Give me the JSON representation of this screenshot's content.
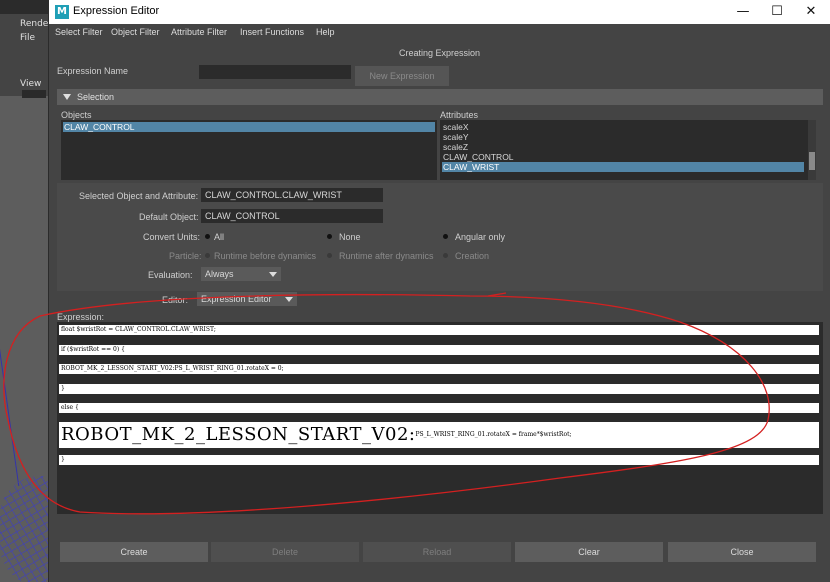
{
  "background": {
    "labels": [
      "Rende",
      "File",
      "View"
    ]
  },
  "window": {
    "title": "Expression Editor",
    "logo": "M",
    "controls": {
      "minimize": "—",
      "maximize": "☐",
      "close": "✕"
    }
  },
  "menu": [
    "Select Filter",
    "Object Filter",
    "Attribute Filter",
    "Insert Functions",
    "Help"
  ],
  "status": "Creating Expression",
  "expression_name": {
    "label": "Expression Name",
    "value": "",
    "new_button": "New Expression"
  },
  "selection": {
    "header": "Selection",
    "objects_label": "Objects",
    "objects": [
      "CLAW_CONTROL"
    ],
    "attributes_label": "Attributes",
    "attributes": [
      "scaleX",
      "scaleY",
      "scaleZ",
      "CLAW_CONTROL",
      "CLAW_WRIST"
    ]
  },
  "fields": {
    "selected_label": "Selected Object and Attribute:",
    "selected_value": "CLAW_CONTROL.CLAW_WRIST",
    "default_label": "Default Object:",
    "default_value": "CLAW_CONTROL",
    "convert_label": "Convert Units:",
    "convert_options": [
      "All",
      "None",
      "Angular only"
    ],
    "particle_label": "Particle:",
    "particle_options": [
      "Runtime before dynamics",
      "Runtime after dynamics",
      "Creation"
    ],
    "evaluation_label": "Evaluation:",
    "evaluation_value": "Always",
    "editor_label": "Editor:",
    "editor_value": "Expression Editor"
  },
  "expression": {
    "label": "Expression:",
    "lines": [
      "float $wristRot = CLAW_CONTROL.CLAW_WRIST;",
      "if ($wristRot == 0) {",
      "ROBOT_MK_2_LESSON_START_V02:PS_L_WRIST_RING_01.rotateX = 0;",
      "}",
      "else {"
    ],
    "big_line_large": "ROBOT_MK_2_LESSON_START_V02:",
    "big_line_small": "PS_L_WRIST_RING_01.rotateX = frame*$wristRot;",
    "last_line": "}"
  },
  "buttons": [
    "Create",
    "Delete",
    "Reload",
    "Clear",
    "Close"
  ],
  "colors": {
    "annotation": "#d42020",
    "selection": "#5285a6",
    "accent": "#1f9fb6"
  }
}
